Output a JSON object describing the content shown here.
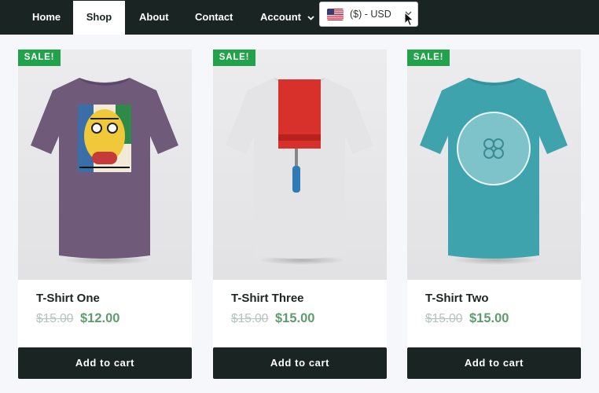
{
  "nav": {
    "items": [
      {
        "label": "Home"
      },
      {
        "label": "Shop",
        "active": true
      },
      {
        "label": "About"
      },
      {
        "label": "Contact"
      },
      {
        "label": "Account",
        "has_dropdown": true
      }
    ]
  },
  "currency": {
    "flag_icon": "us-flag-icon",
    "label": "($) - USD"
  },
  "products": [
    {
      "badge": "SALE!",
      "title": "T-Shirt One",
      "old_price": "$15.00",
      "price": "$12.00",
      "button": "Add to cart",
      "shirt_color": "#6f5a7a"
    },
    {
      "badge": "SALE!",
      "title": "T-Shirt Three",
      "old_price": "$15.00",
      "price": "$15.00",
      "button": "Add to cart",
      "shirt_color": "#e6e6e6"
    },
    {
      "badge": "SALE!",
      "title": "T-Shirt Two",
      "old_price": "$15.00",
      "price": "$15.00",
      "button": "Add to cart",
      "shirt_color": "#3fa3ae"
    }
  ],
  "colors": {
    "nav_bg": "#1a2422",
    "sale_badge": "#22a24a",
    "price": "#5e9c6e",
    "old_price": "#b4c3bd"
  }
}
